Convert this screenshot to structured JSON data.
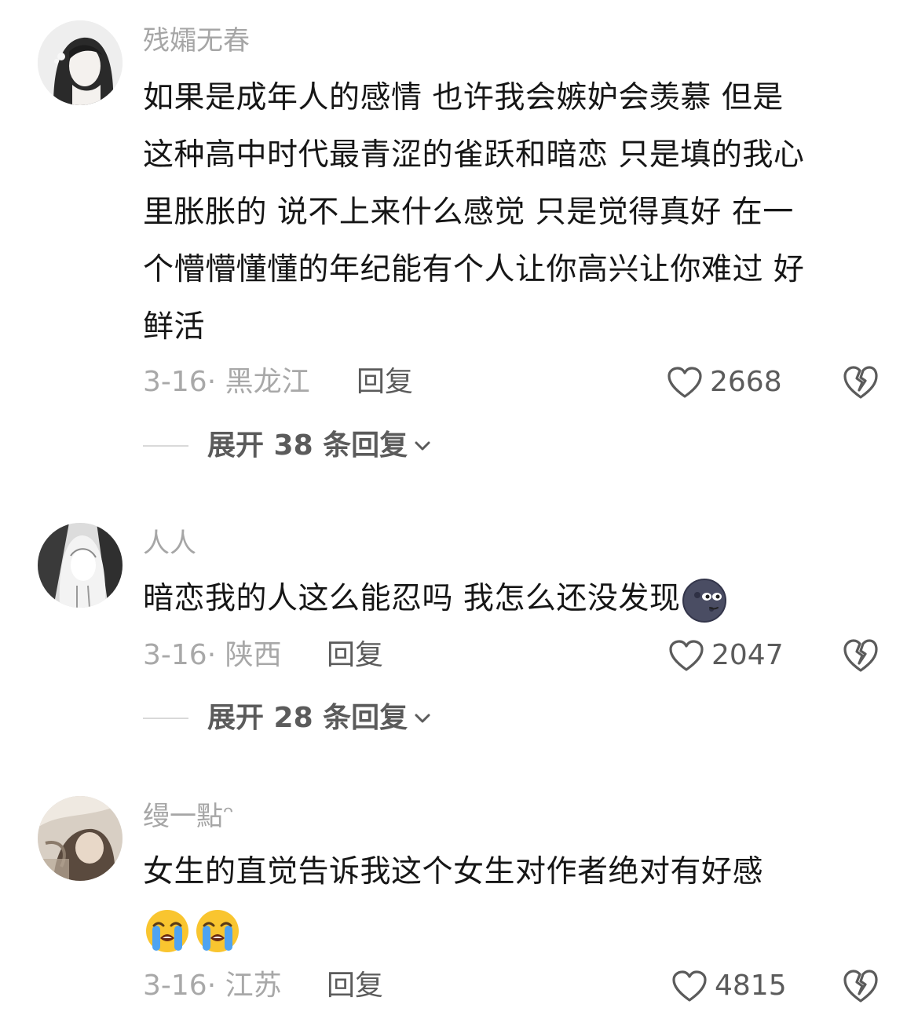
{
  "comments": [
    {
      "username": "残孀无春",
      "lines": [
        "如果是成年人的感情 也许我会嫉妒会羡慕 但是",
        "这种高中时代最青涩的雀跃和暗恋 只是填的我心",
        "里胀胀的 说不上来什么感觉 只是觉得真好 在一",
        "个懵懵懂懂的年纪能有个人让你高兴让你难过 好",
        "鲜活"
      ],
      "meta": "3-16· 黑龙江",
      "reply_label": "回复",
      "likes": "2668",
      "expand_label": "展开 38 条回复"
    },
    {
      "username": "人人",
      "lines": [
        "暗恋我的人这么能忍吗 我怎么还没发现"
      ],
      "emoji": "new-moon-face",
      "meta": "3-16· 陕西",
      "reply_label": "回复",
      "likes": "2047",
      "expand_label": "展开 28 条回复"
    },
    {
      "username": "缦一點ᵔ",
      "lines": [
        "女生的直觉告诉我这个女生对作者绝对有好感"
      ],
      "emoji": "loudly-crying-face ×2",
      "meta": "3-16· 江苏",
      "reply_label": "回复",
      "likes": "4815"
    }
  ],
  "colors": {
    "text": "#161616",
    "muted": "#a6a6a6",
    "action": "#5b5b5b",
    "divider": "#d9d9d9"
  }
}
